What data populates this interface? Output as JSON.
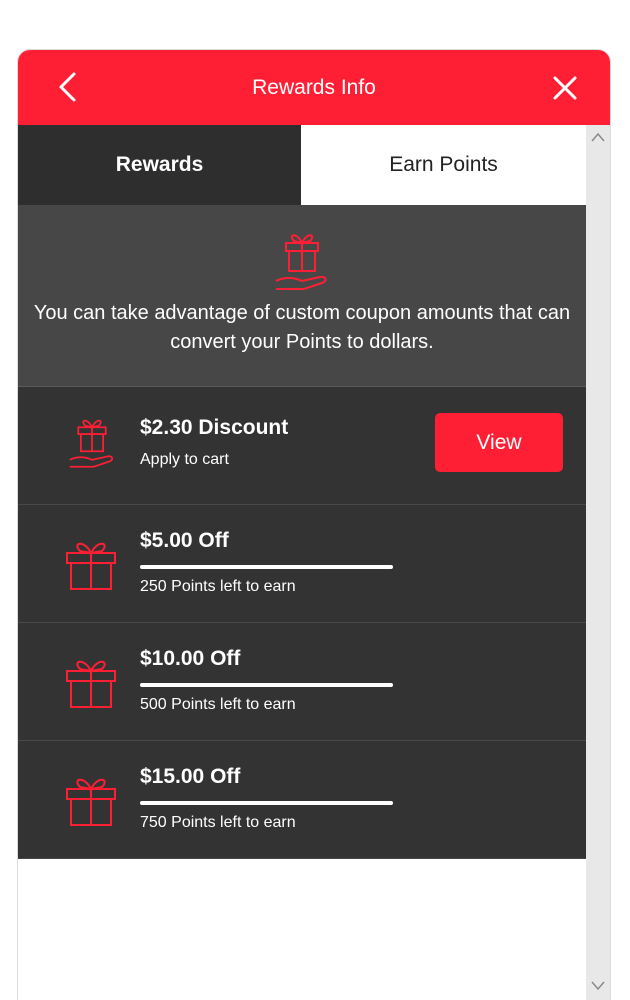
{
  "header": {
    "title": "Rewards Info",
    "back_icon": "chevron-left-icon",
    "close_icon": "close-icon",
    "background": "#ff1f35"
  },
  "tabs": [
    {
      "label": "Rewards",
      "active": true
    },
    {
      "label": "Earn Points",
      "active": false
    }
  ],
  "intro": {
    "icon": "gift-hand-icon",
    "text": "You can take advantage of custom coupon amounts that can convert your Points to dollars."
  },
  "rewards": [
    {
      "title": "$2.30 Discount",
      "subtitle": "Apply to cart",
      "button": "View",
      "icon": "gift-hand-icon",
      "progress": 1.0
    },
    {
      "title": "$5.00 Off",
      "subtitle": "250 Points left to earn",
      "icon": "gift-icon",
      "progress": 1.0
    },
    {
      "title": "$10.00 Off",
      "subtitle": "500 Points left to earn",
      "icon": "gift-icon",
      "progress": 1.0
    },
    {
      "title": "$15.00 Off",
      "subtitle": "750 Points left to earn",
      "icon": "gift-icon",
      "progress": 1.0
    }
  ],
  "colors": {
    "accent": "#ff1f35",
    "dark": "#333333",
    "intro": "#474747"
  }
}
